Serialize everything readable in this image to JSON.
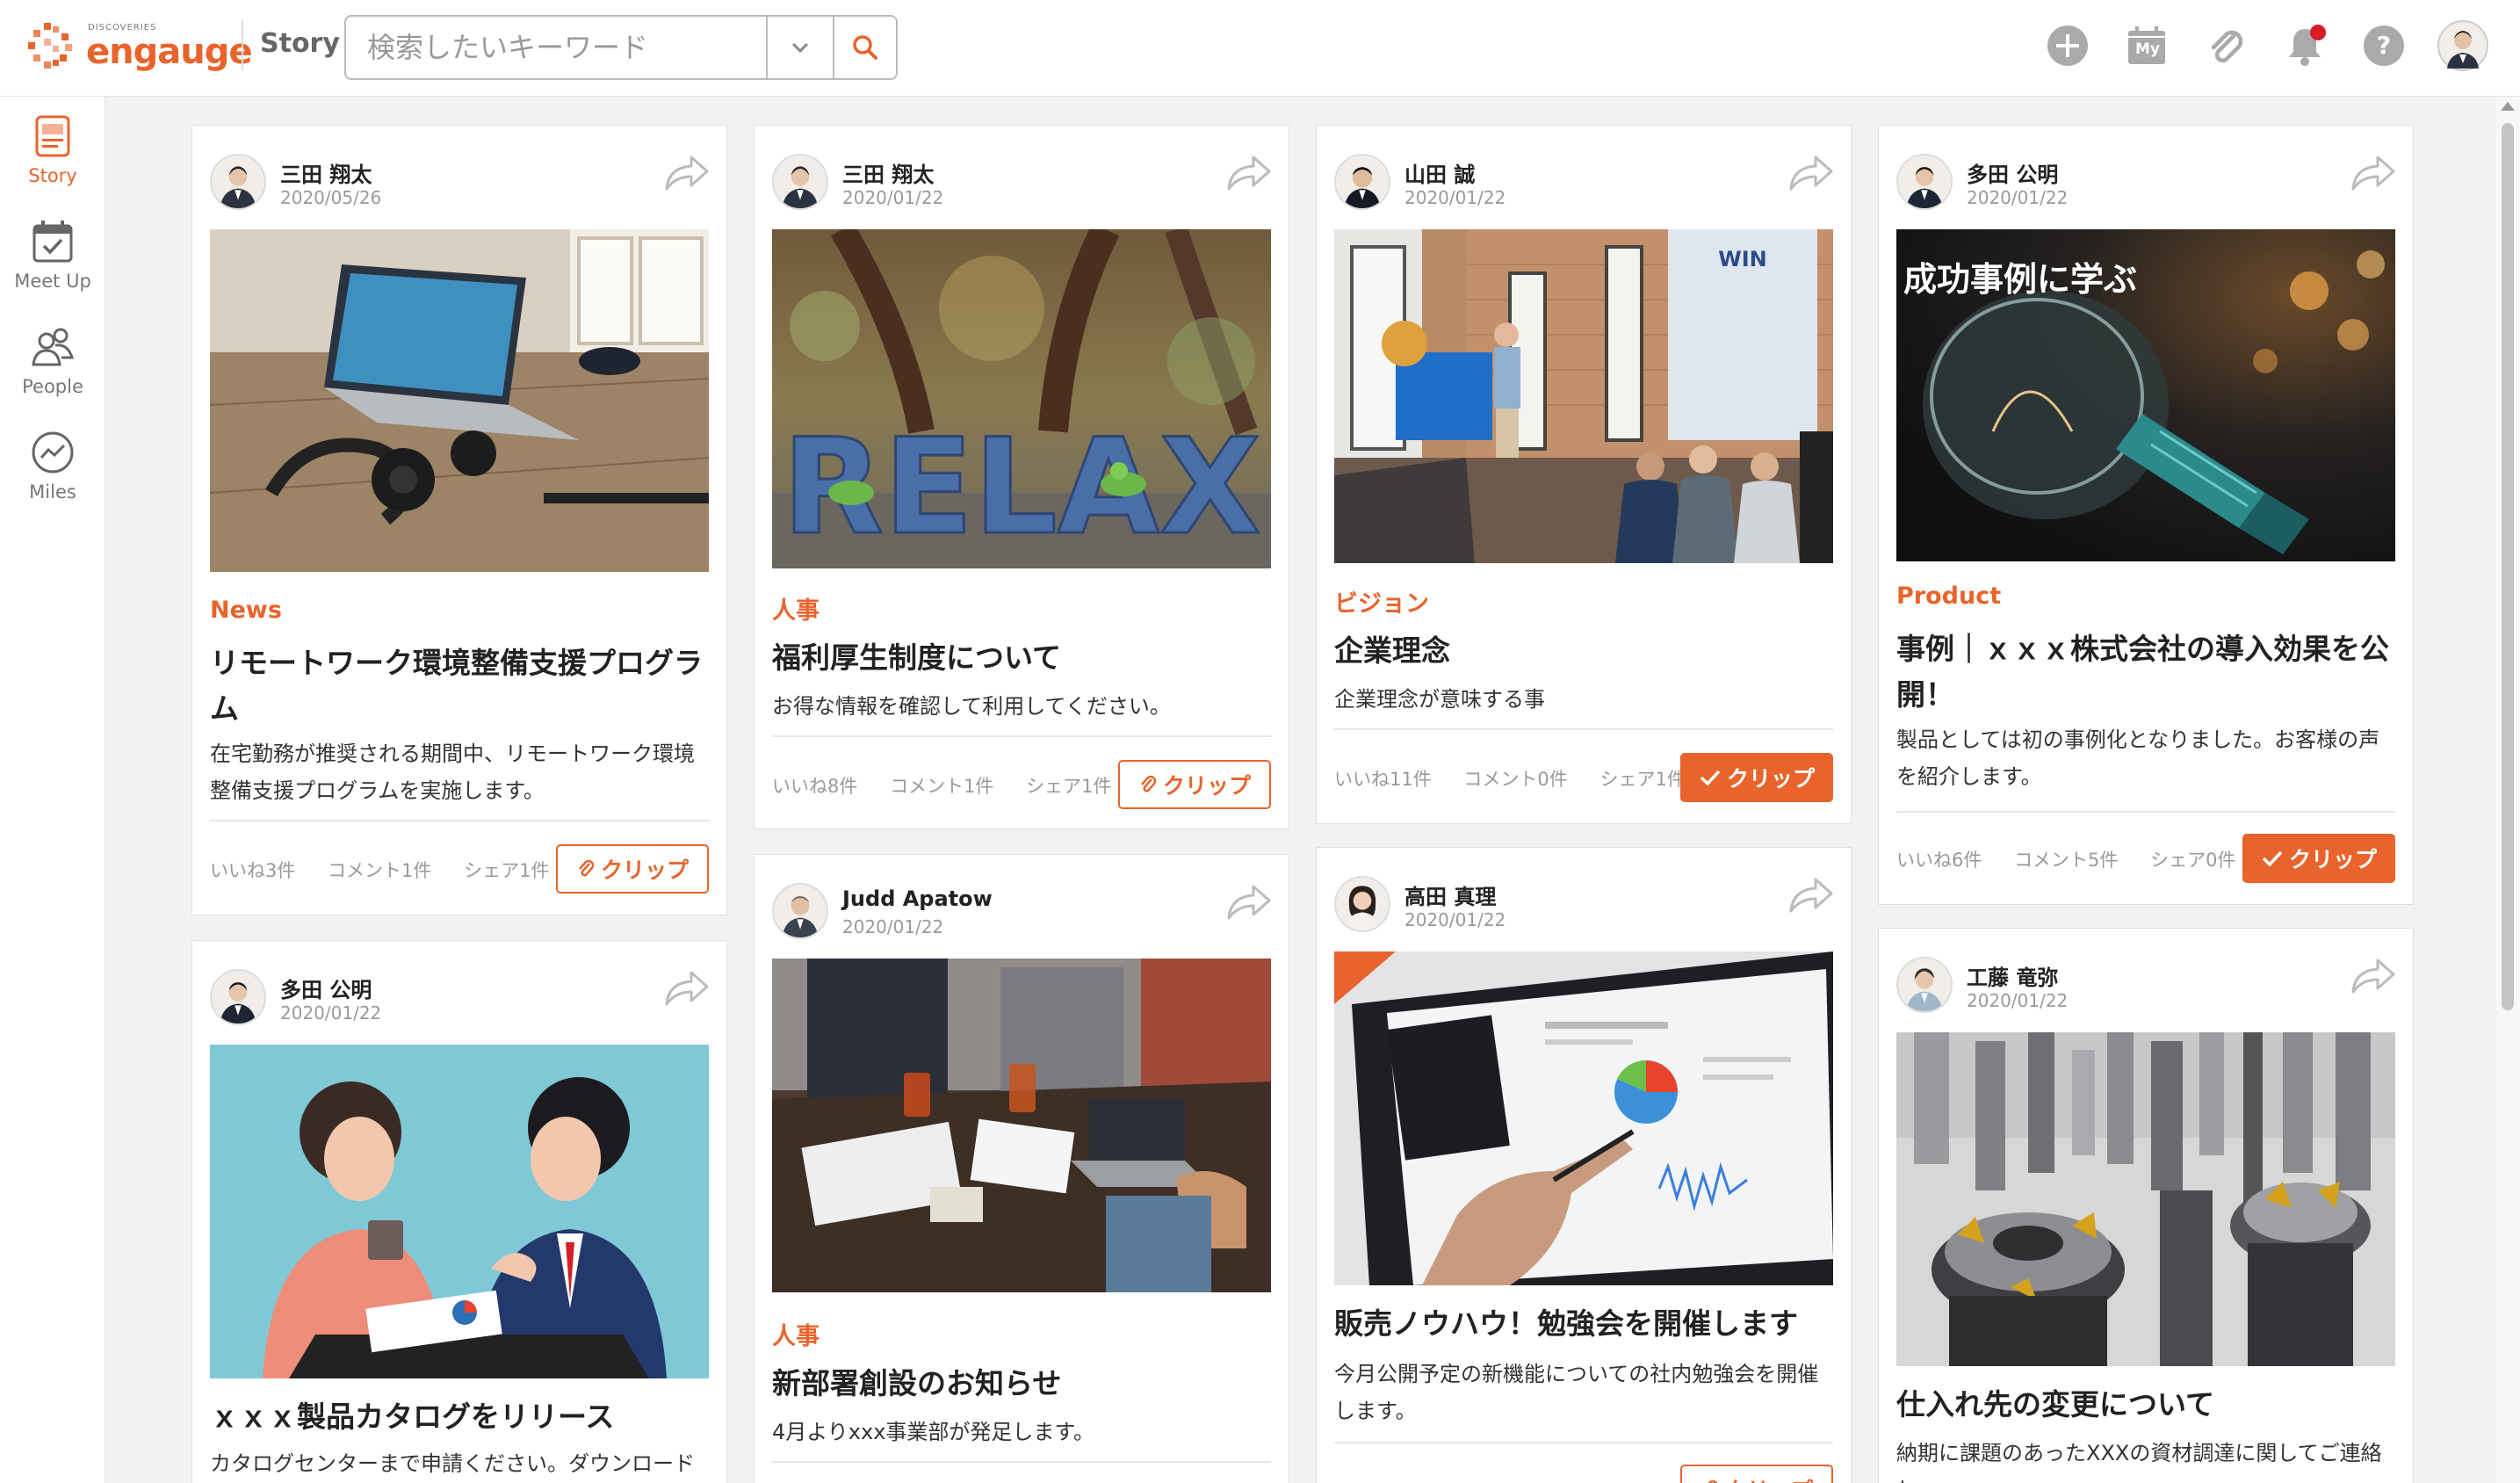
{
  "header": {
    "logo_small": "DISCOVERIES",
    "logo_word": "engauge",
    "page_title": "Story",
    "search_placeholder": "検索したいキーワード",
    "icons": [
      "plus-icon",
      "my-calendar-icon",
      "paperclip-icon",
      "bell-icon",
      "help-icon",
      "user-avatar"
    ],
    "my_label": "My"
  },
  "sidebar": {
    "items": [
      {
        "label": "Story",
        "icon": "story-icon",
        "active": true
      },
      {
        "label": "Meet Up",
        "icon": "meetup-icon",
        "active": false
      },
      {
        "label": "People",
        "icon": "people-icon",
        "active": false
      },
      {
        "label": "Miles",
        "icon": "miles-icon",
        "active": false
      }
    ]
  },
  "cards": [
    {
      "author": "三田 翔太",
      "date": "2020/05/26",
      "category": "News",
      "title": "リモートワーク環境整備支援プログラム",
      "desc": "在宅勤務が推奨される期間中、リモートワーク環境整備支援プログラムを実施します。",
      "likes": "いいね3件",
      "comments": "コメント1件",
      "shares": "シェア1件",
      "clip": "クリップ",
      "clipped": false
    },
    {
      "author": "三田 翔太",
      "date": "2020/01/22",
      "category": "人事",
      "title": "福利厚生制度について",
      "desc": "お得な情報を確認して利用してください。",
      "likes": "いいね8件",
      "comments": "コメント1件",
      "shares": "シェア1件",
      "clip": "クリップ",
      "clipped": false,
      "image_text": "RELAX"
    },
    {
      "author": "山田 誠",
      "date": "2020/01/22",
      "category": "ビジョン",
      "title": "企業理念",
      "desc": "企業理念が意味する事",
      "likes": "いいね11件",
      "comments": "コメント0件",
      "shares": "シェア1件",
      "clip": "クリップ",
      "clipped": true,
      "image_text": "WIN"
    },
    {
      "author": "多田 公明",
      "date": "2020/01/22",
      "category": "Product",
      "title": "事例｜ｘｘｘ株式会社の導入効果を公開！",
      "desc": "製品としては初の事例化となりました。お客様の声を紹介します。",
      "likes": "いいね6件",
      "comments": "コメント5件",
      "shares": "シェア0件",
      "clip": "クリップ",
      "clipped": true,
      "image_text": "成功事例に学ぶ"
    },
    {
      "author": "多田 公明",
      "date": "2020/01/22",
      "category": "",
      "title": "ｘｘｘ製品カタログをリリース",
      "desc": "カタログセンターまで申請ください。ダウンロード"
    },
    {
      "author": "Judd Apatow",
      "date": "2020/01/22",
      "category": "人事",
      "title": "新部署創設のお知らせ",
      "desc": "4月よりxxx事業部が発足します。"
    },
    {
      "author": "高田 真理",
      "date": "2020/01/22",
      "category": "",
      "title": "販売ノウハウ！勉強会を開催します",
      "desc": "今月公開予定の新機能についての社内勉強会を開催します。",
      "clip": "クリップ"
    },
    {
      "author": "工藤 竜弥",
      "date": "2020/01/22",
      "category": "",
      "title": "仕入れ先の変更について",
      "desc": "納期に課題のあったXXXの資材調達に関してご連絡し"
    }
  ],
  "colors": {
    "accent": "#e8642c",
    "notification": "#d81c24"
  }
}
